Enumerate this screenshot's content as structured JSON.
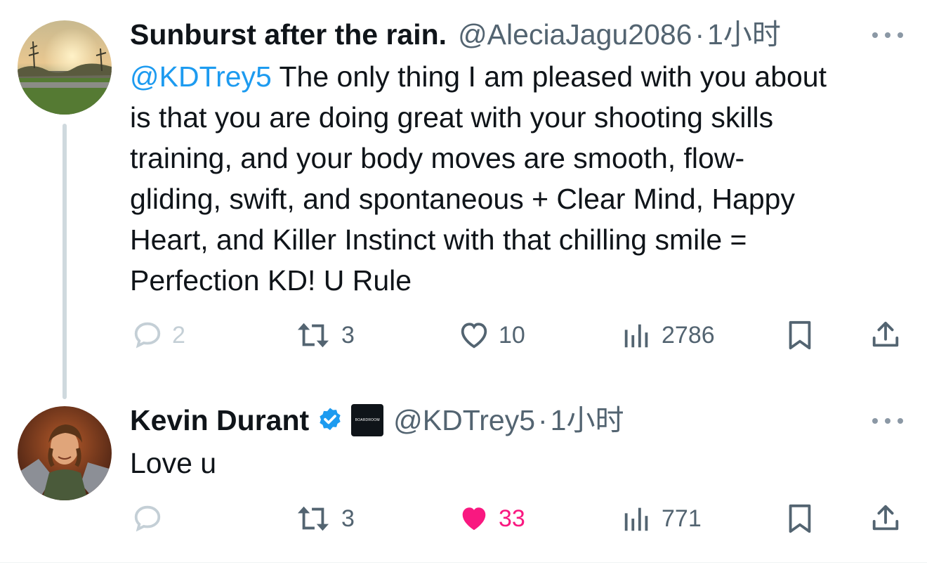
{
  "tweets": [
    {
      "display_name": "Sunburst after the rain.",
      "handle": "@AleciaJagu2086",
      "separator": "·",
      "time": "1小时",
      "text_mention": "@KDTrey5",
      "text_body": " The only thing I am pleased with you about\nis that you are doing great with your shooting skills\ntraining, and your body moves are smooth, flow-\ngliding, swift, and spontaneous + Clear Mind, Happy\nHeart, and Killer Instinct with that chilling smile =\nPerfection KD! U Rule",
      "actions": {
        "replies": "2",
        "retweets": "3",
        "likes": "10",
        "views": "2786"
      },
      "liked": false
    },
    {
      "display_name": "Kevin Durant",
      "verified": true,
      "affiliate_badge_text": "BOARDROOM",
      "handle": "@KDTrey5",
      "separator": "·",
      "time": "1小时",
      "text_body": "Love u",
      "actions": {
        "replies": "",
        "retweets": "3",
        "likes": "33",
        "views": "771"
      },
      "liked": true
    }
  ],
  "colors": {
    "link": "#1d9bf0",
    "like_active": "#f91880",
    "secondary_text": "#536471",
    "thread_line": "#cfd9de"
  }
}
